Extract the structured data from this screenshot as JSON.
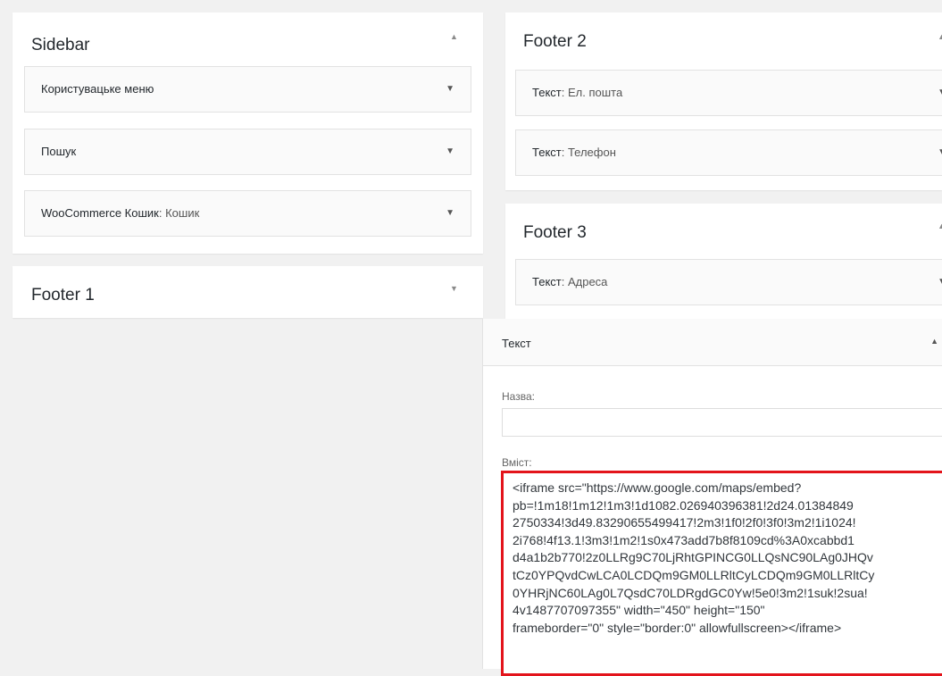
{
  "sidebar": {
    "title": "Sidebar",
    "toggle": "▲",
    "widgets": [
      {
        "title": "Користувацьке меню",
        "subtitle": "",
        "toggle": "▼"
      },
      {
        "title": "Пошук",
        "subtitle": "",
        "toggle": "▼"
      },
      {
        "title": "WooCommerce Кошик",
        "subtitle": ": Кошик",
        "toggle": "▼"
      }
    ]
  },
  "footer1": {
    "title": "Footer 1",
    "toggle": "▼"
  },
  "footer2": {
    "title": "Footer 2",
    "toggle": "▲",
    "widgets": [
      {
        "title": "Текст",
        "subtitle": ": Ел. пошта",
        "toggle": "▼"
      },
      {
        "title": "Текст",
        "subtitle": ": Телефон",
        "toggle": "▼"
      }
    ]
  },
  "footer3": {
    "title": "Footer 3",
    "toggle": "▲",
    "widgets": [
      {
        "title": "Текст",
        "subtitle": ": Адреса",
        "toggle": "▼"
      }
    ]
  },
  "text_widget": {
    "title": "Текст",
    "toggle": "▲",
    "name_label": "Назва:",
    "name_value": "",
    "content_label": "Вміст:",
    "content": "<iframe src=\"https://www.google.com/maps/embed?\npb=!1m18!1m12!1m3!1d1082.026940396381!2d24.01384849\n2750334!3d49.83290655499417!2m3!1f0!2f0!3f0!3m2!1i1024!\n2i768!4f13.1!3m3!1m2!1s0x473add7b8f8109cd%3A0xcabbd1\nd4a1b2b770!2z0LLRg9C70LjRhtGPINCG0LLQsNC90LAg0JHQv\ntCz0YPQvdCwLCA0LCDQm9GM0LLRltCyLCDQm9GM0LLRltCy\n0YHRjNC60LAg0L7QsdC70LDRgdGC0Yw!5e0!3m2!1suk!2sua!\n4v1487707097355\" width=\"450\" height=\"150\"\nframeborder=\"0\" style=\"border:0\" allowfullscreen></iframe>"
  }
}
